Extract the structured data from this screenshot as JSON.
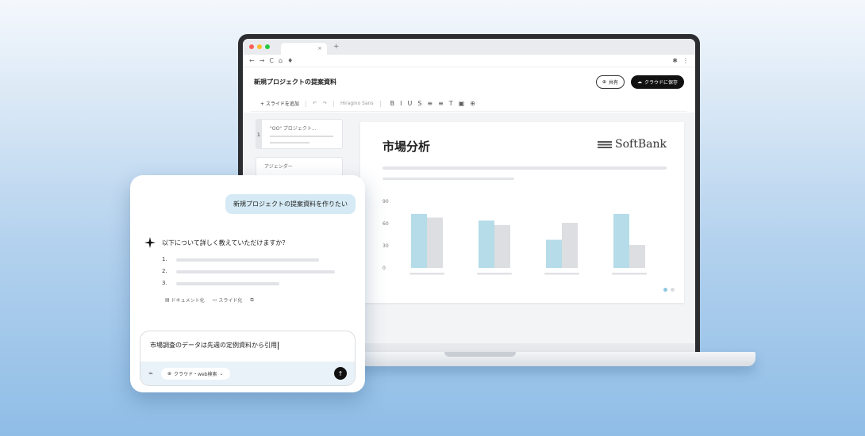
{
  "banner": {
    "text": ""
  },
  "browser": {
    "tab_close": "×",
    "new_tab": "+",
    "nav": [
      "←",
      "→",
      "C",
      "⌂",
      "♦"
    ],
    "menu": "⋮",
    "traffic_colors": [
      "#ff5f57",
      "#febc2e",
      "#28c840"
    ]
  },
  "document": {
    "title": "新規プロジェクトの提案資料",
    "share_label": "共有",
    "save_label": "クラウドに保存"
  },
  "toolbar": {
    "add_slide": "+ スライドを追加",
    "font": "Hiragino Sans",
    "icons": [
      "B",
      "I",
      "U",
      "S",
      "≡",
      "≡",
      "T",
      "▣",
      "⊕"
    ]
  },
  "slides_panel": {
    "items": [
      {
        "num": "1",
        "label": "\"OO\" プロジェクト..."
      },
      {
        "num": "2",
        "label": "アジェンダー"
      }
    ]
  },
  "slide": {
    "title": "市場分析",
    "brand": "SoftBank",
    "page_dot_colors": [
      "#8ec8e0",
      "#d8dbdf"
    ]
  },
  "chart_data": {
    "type": "bar",
    "categories": [
      "",
      "",
      "",
      ""
    ],
    "series": [
      {
        "values": [
          73,
          64,
          38,
          73
        ]
      },
      {
        "values": [
          68,
          58,
          61,
          31
        ]
      }
    ],
    "yticks": [
      "90",
      "60",
      "30",
      "0"
    ],
    "ylim": [
      0,
      90
    ],
    "colors": [
      "#b5dce8",
      "#dcdee1"
    ],
    "grid": false,
    "legend": "none"
  },
  "chat": {
    "user_message": "新規プロジェクトの提案資料を作りたい",
    "ai_question": "以下について詳しく教えていただけますか？",
    "list_numbers": [
      "1.",
      "2.",
      "3."
    ],
    "chips": [
      "ドキュメント化",
      "スライド化"
    ],
    "input_value": "市場調査のデータは先週の定例資料から引用",
    "mode_label": "クラウド・web検索",
    "send_icon": "↑"
  }
}
